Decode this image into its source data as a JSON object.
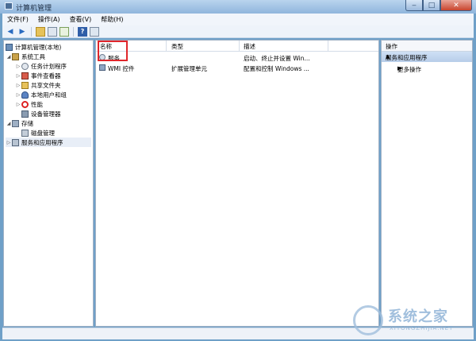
{
  "window": {
    "title": "计算机管理"
  },
  "menu": [
    "文件(F)",
    "操作(A)",
    "查看(V)",
    "帮助(H)"
  ],
  "tree": [
    {
      "label": "计算机管理(本地)",
      "expander": "",
      "icon": "computer-management-icon"
    },
    {
      "label": "系统工具",
      "expander": "◢",
      "icon": "system-tools-icon"
    },
    {
      "label": "任务计划程序",
      "expander": "▷",
      "icon": "task-scheduler-icon"
    },
    {
      "label": "事件查看器",
      "expander": "▷",
      "icon": "event-viewer-icon"
    },
    {
      "label": "共享文件夹",
      "expander": "▷",
      "icon": "shared-folder-icon"
    },
    {
      "label": "本地用户和组",
      "expander": "▷",
      "icon": "local-users-icon"
    },
    {
      "label": "性能",
      "expander": "▷",
      "icon": "performance-icon"
    },
    {
      "label": "设备管理器",
      "expander": "",
      "icon": "device-manager-icon"
    },
    {
      "label": "存储",
      "expander": "◢",
      "icon": "storage-icon"
    },
    {
      "label": "磁盘管理",
      "expander": "",
      "icon": "disk-management-icon"
    },
    {
      "label": "服务和应用程序",
      "expander": "▷",
      "icon": "services-apps-icon"
    }
  ],
  "list": {
    "columns": [
      "名称",
      "类型",
      "描述"
    ],
    "rows": [
      {
        "name": "服务",
        "type": "",
        "desc": "启动、终止并设置 Win...",
        "icon": "services-icon"
      },
      {
        "name": "WMI 控件",
        "type": "扩展管理单元",
        "desc": "配置和控制 Windows ...",
        "icon": "wmi-icon"
      }
    ]
  },
  "actions": {
    "title": "操作",
    "group": "服务和应用程序",
    "more": "更多操作"
  },
  "watermark": {
    "text": "系统之家",
    "sub": "XITONGZHIJIA.NET"
  },
  "colors": {
    "highlight_box": "#e0262b",
    "frame": "#6fa0c8",
    "action_group": "#b7cde9"
  }
}
